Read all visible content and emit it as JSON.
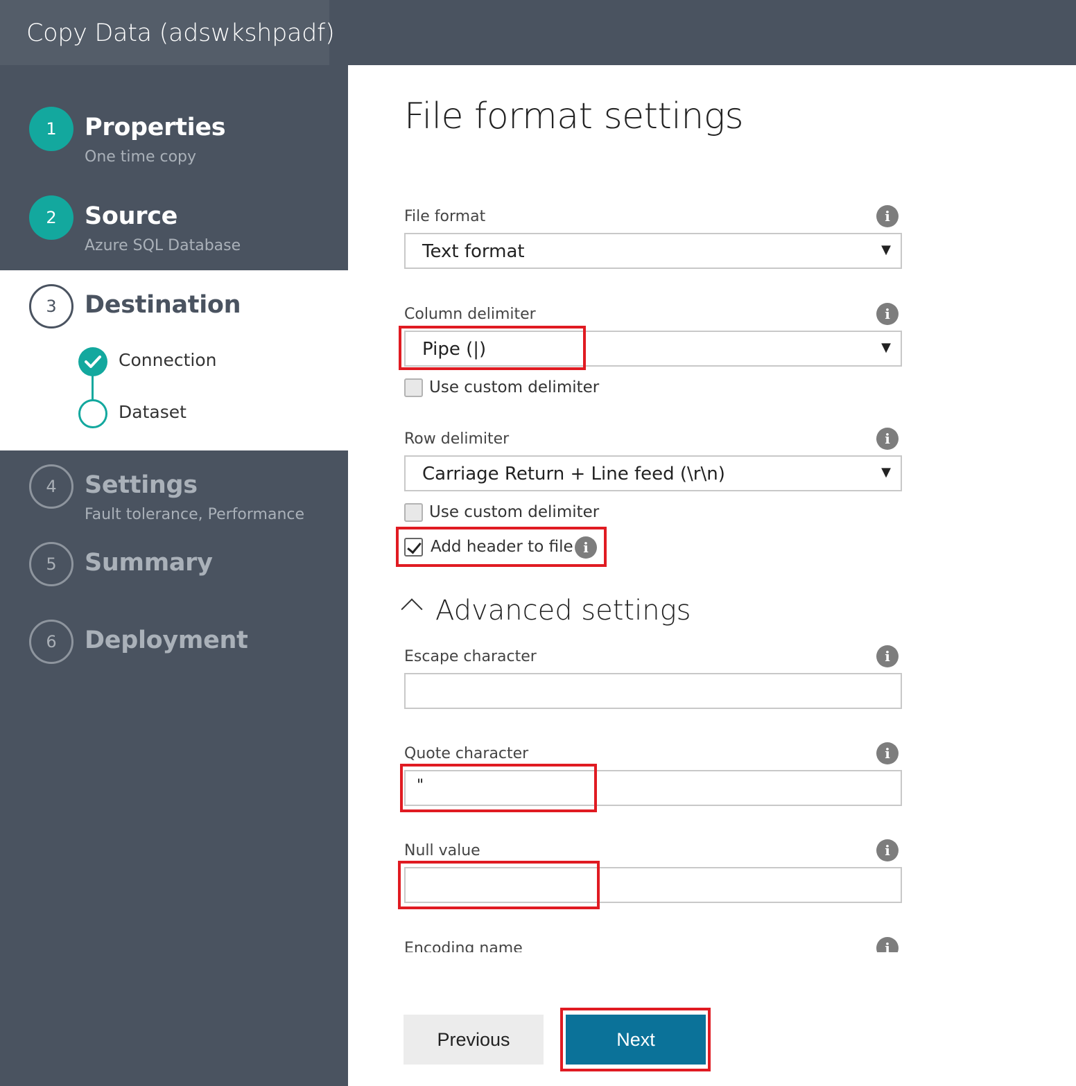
{
  "window": {
    "title": "Copy Data (adswkshpadf)"
  },
  "steps": [
    {
      "number": "1",
      "label": "Properties",
      "sub": "One time copy",
      "status": "done"
    },
    {
      "number": "2",
      "label": "Source",
      "sub": "Azure SQL Database",
      "status": "done"
    },
    {
      "number": "3",
      "label": "Destination",
      "status": "active",
      "substeps": [
        {
          "label": "Connection",
          "status": "done"
        },
        {
          "label": "Dataset",
          "status": "current"
        }
      ]
    },
    {
      "number": "4",
      "label": "Settings",
      "sub": "Fault tolerance, Performance",
      "status": "pending"
    },
    {
      "number": "5",
      "label": "Summary",
      "status": "pending"
    },
    {
      "number": "6",
      "label": "Deployment",
      "status": "pending"
    }
  ],
  "main": {
    "title": "File format settings",
    "file_format": {
      "label": "File format",
      "value": "Text format"
    },
    "column_delimiter": {
      "label": "Column delimiter",
      "value": "Pipe (|)",
      "custom_label": "Use custom delimiter",
      "custom_checked": false
    },
    "row_delimiter": {
      "label": "Row delimiter",
      "value": "Carriage Return + Line feed (\\r\\n)",
      "custom_label": "Use custom delimiter",
      "custom_checked": false
    },
    "add_header": {
      "label": "Add header to file",
      "checked": true
    },
    "advanced": {
      "title": "Advanced settings",
      "escape_character": {
        "label": "Escape character",
        "value": ""
      },
      "quote_character": {
        "label": "Quote character",
        "value": "\""
      },
      "null_value": {
        "label": "Null value",
        "value": ""
      },
      "encoding_name": {
        "label": "Encoding name"
      }
    },
    "info_glyph": "i",
    "dropdown_arrow": "▼"
  },
  "footer": {
    "previous_label": "Previous",
    "next_label": "Next"
  },
  "colors": {
    "accent": "#13a89e",
    "sidebar": "#4a5360",
    "primary_button": "#0b7299",
    "highlight": "#e01b22"
  }
}
